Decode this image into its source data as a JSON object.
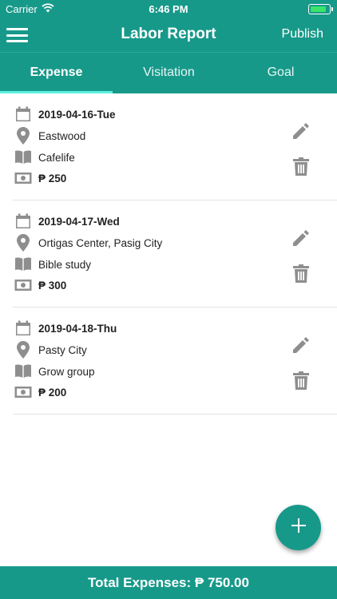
{
  "status_bar": {
    "carrier": "Carrier",
    "time": "6:46 PM"
  },
  "nav": {
    "title": "Labor Report",
    "publish_label": "Publish"
  },
  "tabs": [
    {
      "label": "Expense",
      "active": true
    },
    {
      "label": "Visitation",
      "active": false
    },
    {
      "label": "Goal",
      "active": false
    }
  ],
  "entries": [
    {
      "date": "2019-04-16-Tue",
      "location": "Eastwood",
      "activity": "Cafelife",
      "amount": "₱ 250"
    },
    {
      "date": "2019-04-17-Wed",
      "location": "Ortigas Center, Pasig City",
      "activity": "Bible study",
      "amount": "₱ 300"
    },
    {
      "date": "2019-04-18-Thu",
      "location": "Pasty City",
      "activity": "Grow group",
      "amount": "₱ 200"
    }
  ],
  "footer": {
    "total": "Total Expenses: ₱ 750.00"
  },
  "icons": {
    "calendar": "calendar-icon",
    "location": "map-pin-icon",
    "activity": "book-icon",
    "amount": "cash-icon",
    "edit": "pencil-icon",
    "delete": "trash-icon",
    "add": "plus-icon",
    "menu": "hamburger-menu-icon"
  },
  "colors": {
    "primary": "#17998a",
    "tab_indicator": "#5ff0df",
    "icon_gray": "#8e8e8e"
  }
}
